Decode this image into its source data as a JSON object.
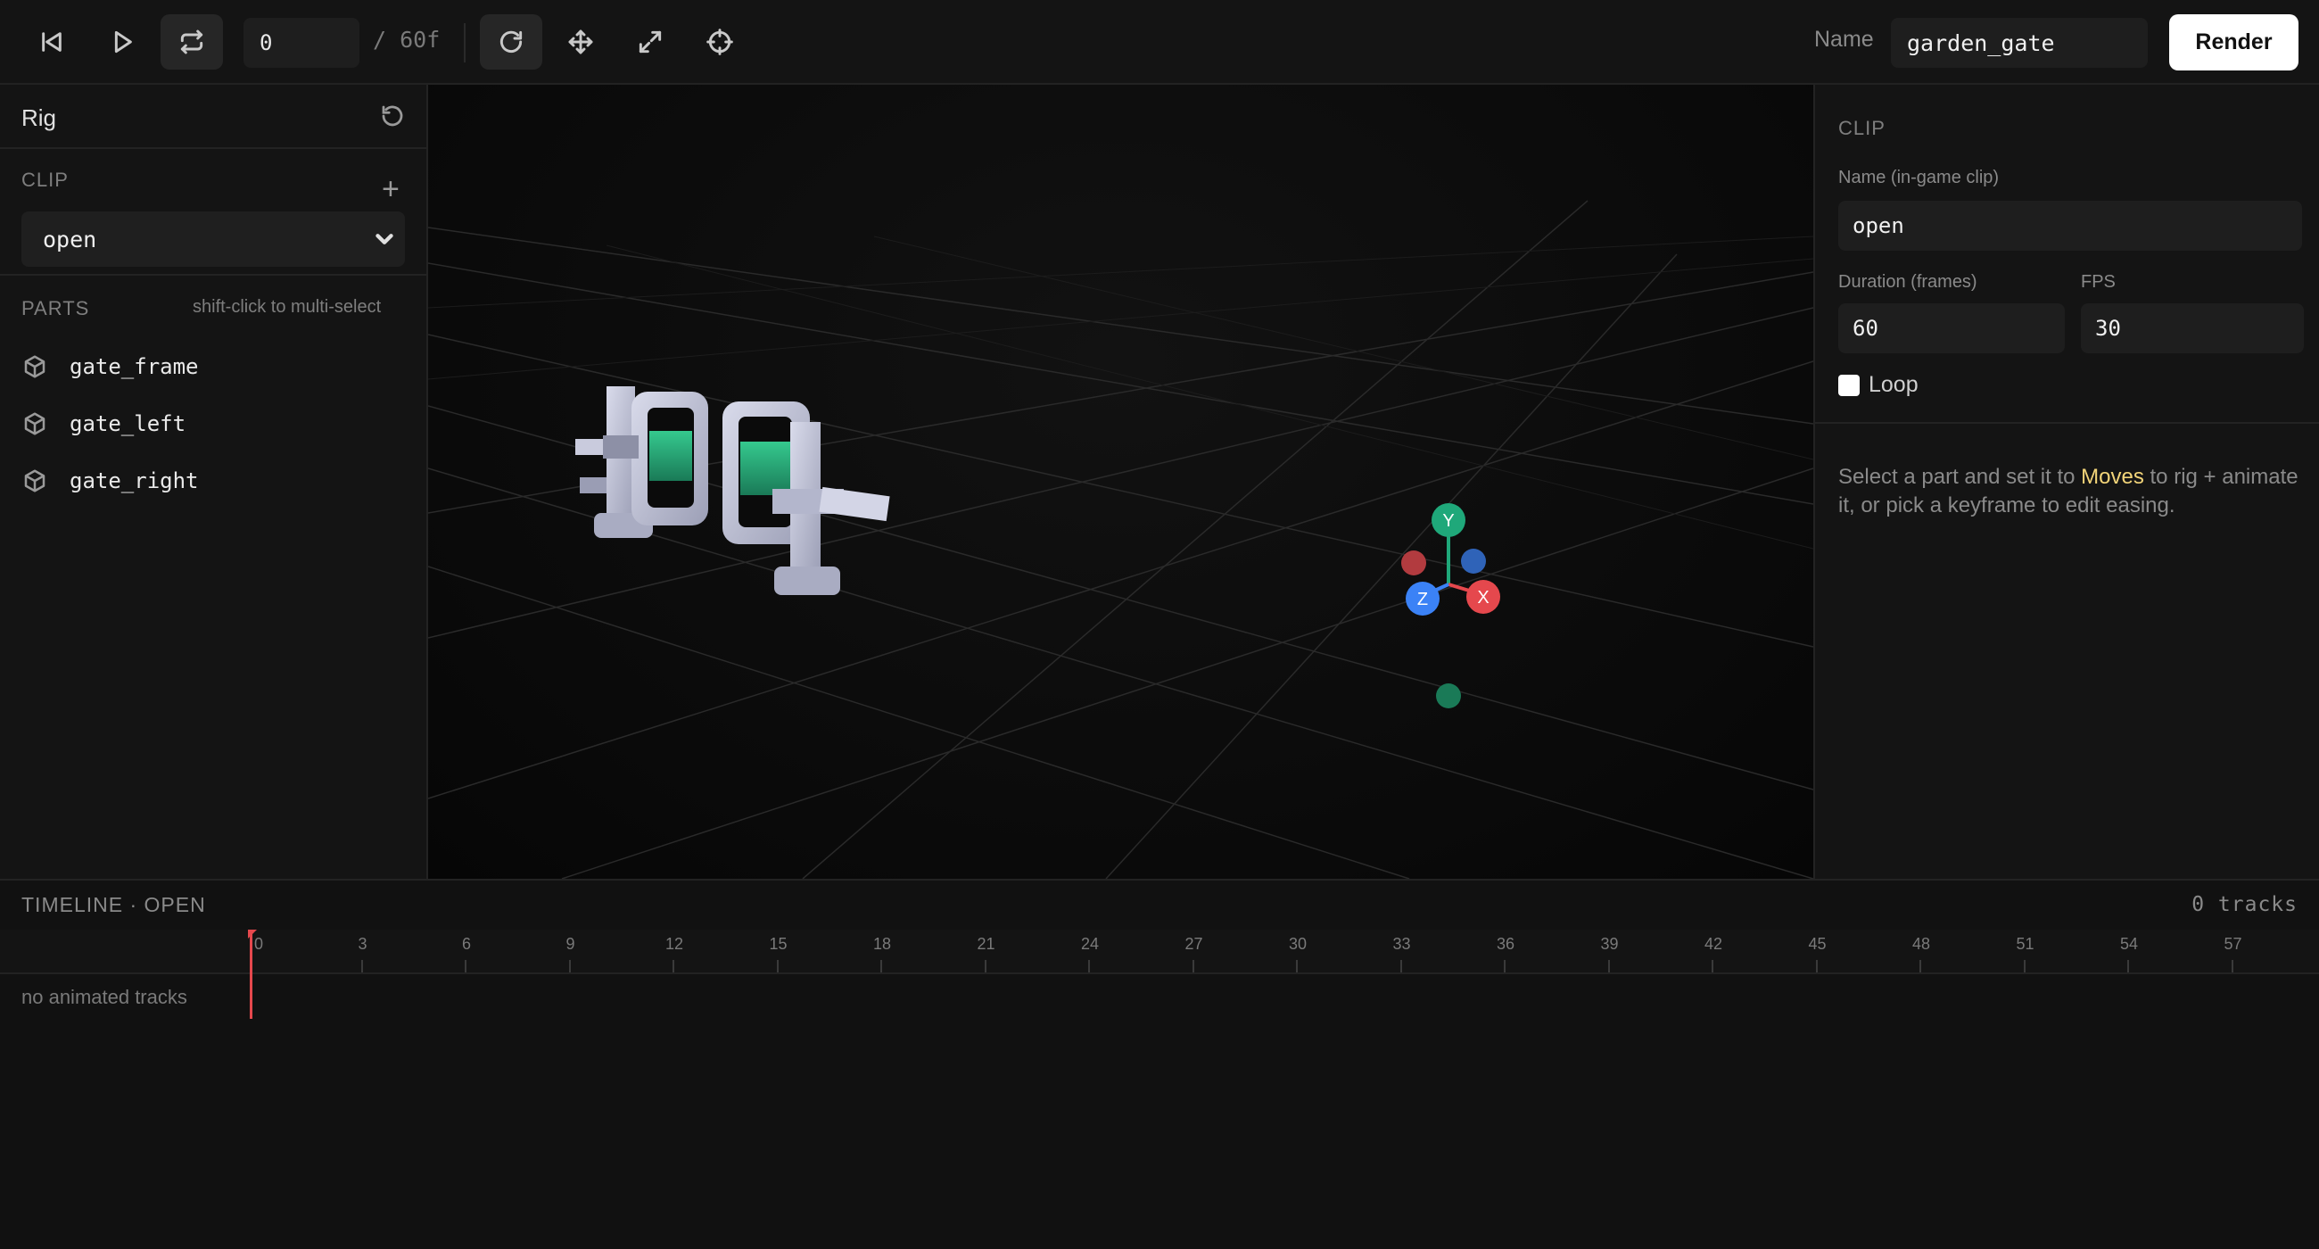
{
  "toolbar": {
    "frame_value": "0",
    "frame_total": "/ 60f",
    "name_label": "Name",
    "name_value": "garden_gate",
    "render_label": "Render",
    "icons": [
      "skip-back-icon",
      "play-icon",
      "loop-icon",
      "rotate-icon",
      "move-icon",
      "scale-icon",
      "target-icon"
    ]
  },
  "left_panel": {
    "title": "Rig",
    "clip_label": "CLIP",
    "clip_selected": "open",
    "parts_label": "PARTS",
    "parts_hint": "shift-click to multi-select",
    "parts": [
      "gate_frame",
      "gate_left",
      "gate_right"
    ]
  },
  "viewport": {
    "gizmo": {
      "x": "X",
      "y": "Y",
      "z": "Z"
    },
    "colors": {
      "x": "#e5484d",
      "y": "#1fa87a",
      "z": "#3b82f6"
    }
  },
  "right_panel": {
    "section_label": "CLIP",
    "name_label": "Name (in-game clip)",
    "name_value": "open",
    "duration_label": "Duration (frames)",
    "duration_value": "60",
    "fps_label": "FPS",
    "fps_value": "30",
    "loop_label": "Loop",
    "loop_checked": false,
    "help_before": "Select a part and set it to ",
    "help_highlight": "Moves",
    "help_after": " to rig + animate it, or pick a keyframe to edit easing."
  },
  "timeline": {
    "title": "TIMELINE · OPEN",
    "tracks": "0 tracks",
    "empty": "no animated tracks",
    "ticks": [
      "0",
      "3",
      "6",
      "9",
      "12",
      "15",
      "18",
      "21",
      "24",
      "27",
      "30",
      "33",
      "36",
      "39",
      "42",
      "45",
      "48",
      "51",
      "54",
      "57"
    ]
  }
}
